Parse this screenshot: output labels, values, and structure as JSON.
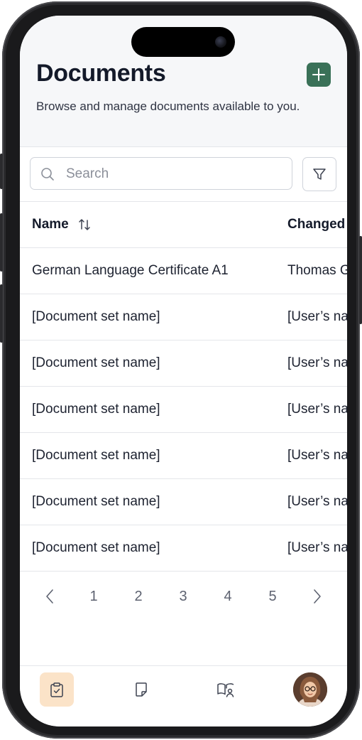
{
  "header": {
    "title": "Documents",
    "subtitle": "Browse and manage documents available to you.",
    "add_icon": "plus-icon",
    "accent": "#3a7158"
  },
  "search": {
    "placeholder": "Search",
    "value": "",
    "icon": "search-icon"
  },
  "filter": {
    "icon": "filter-icon"
  },
  "table": {
    "columns": [
      {
        "label": "Name",
        "sort_icon": "sort-arrows-icon"
      },
      {
        "label": "Changed"
      }
    ],
    "rows": [
      {
        "name": "German Language Certificate A1",
        "changed": "Thomas G"
      },
      {
        "name": "[Document set name]",
        "changed": "[User’s na"
      },
      {
        "name": "[Document set name]",
        "changed": "[User’s na"
      },
      {
        "name": "[Document set name]",
        "changed": "[User’s na"
      },
      {
        "name": "[Document set name]",
        "changed": "[User’s na"
      },
      {
        "name": "[Document set name]",
        "changed": "[User’s na"
      },
      {
        "name": "[Document set name]",
        "changed": "[User’s na"
      }
    ]
  },
  "pagination": {
    "prev_icon": "chevron-left-icon",
    "next_icon": "chevron-right-icon",
    "pages": [
      "1",
      "2",
      "3",
      "4",
      "5"
    ]
  },
  "bottom_nav": {
    "items": [
      {
        "icon": "clipboard-check-icon",
        "active": true
      },
      {
        "icon": "document-icon",
        "active": false
      },
      {
        "icon": "book-person-icon",
        "active": false
      },
      {
        "icon": "user-avatar",
        "active": false
      }
    ],
    "active_color": "#fbe3c8"
  }
}
